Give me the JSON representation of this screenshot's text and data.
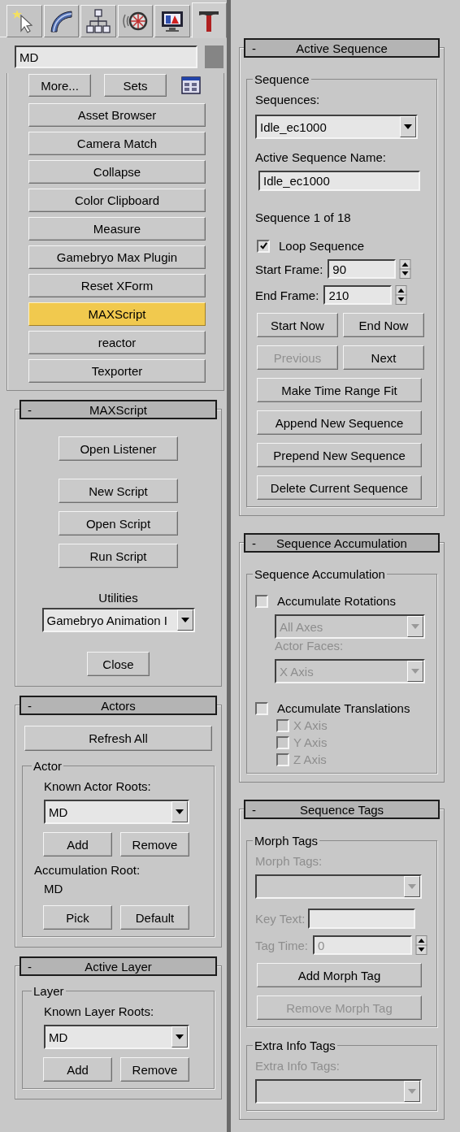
{
  "command_tabs": [
    {
      "kind": "create",
      "selected": false
    },
    {
      "kind": "modify",
      "selected": false
    },
    {
      "kind": "hierarchy",
      "selected": false
    },
    {
      "kind": "motion",
      "selected": false
    },
    {
      "kind": "display",
      "selected": false
    },
    {
      "kind": "utilities",
      "selected": true
    }
  ],
  "name_field": {
    "value": "MD"
  },
  "utilities": {
    "more_button": "More...",
    "sets_button": "Sets",
    "buttons": [
      {
        "label": "Asset Browser",
        "selected": false
      },
      {
        "label": "Camera Match",
        "selected": false
      },
      {
        "label": "Collapse",
        "selected": false
      },
      {
        "label": "Color Clipboard",
        "selected": false
      },
      {
        "label": "Measure",
        "selected": false
      },
      {
        "label": "Gamebryo Max Plugin",
        "selected": false
      },
      {
        "label": "Reset XForm",
        "selected": false
      },
      {
        "label": "MAXScript",
        "selected": true
      },
      {
        "label": "reactor",
        "selected": false
      },
      {
        "label": "Texporter",
        "selected": false
      }
    ]
  },
  "maxscript": {
    "collapse": "-",
    "title": "MAXScript",
    "buttons": [
      "Open Listener",
      "New Script",
      "Open Script",
      "Run Script"
    ],
    "utilities_label": "Utilities",
    "utilities_dropdown": "Gamebryo Animation I",
    "close_button": "Close"
  },
  "actors": {
    "collapse": "-",
    "title": "Actors",
    "refresh_button": "Refresh All",
    "group_label": "Actor",
    "roots_label": "Known Actor Roots:",
    "roots_dropdown": "MD",
    "add_button": "Add",
    "remove_button": "Remove",
    "accumulation_label": "Accumulation Root:",
    "accumulation_value": "MD",
    "pick_button": "Pick",
    "default_button": "Default"
  },
  "active_layer": {
    "collapse": "-",
    "title": "Active Layer",
    "group_label": "Layer",
    "roots_label": "Known Layer Roots:",
    "roots_dropdown": "MD",
    "add_button": "Add",
    "remove_button": "Remove"
  },
  "active_sequence": {
    "collapse": "-",
    "title": "Active Sequence",
    "group_label": "Sequence",
    "sequences_label": "Sequences:",
    "sequences_dropdown": "Idle_ec1000",
    "name_label": "Active Sequence Name:",
    "name_value": "Idle_ec1000",
    "counter": "Sequence 1 of 18",
    "loop": {
      "label": "Loop Sequence",
      "checked": true
    },
    "start_label": "Start Frame:",
    "start_value": "90",
    "end_label": "End Frame:",
    "end_value": "210",
    "button_rows": [
      {
        "buttons": [
          {
            "label": "Start Now",
            "disabled": false
          },
          {
            "label": "End Now",
            "disabled": false
          }
        ]
      },
      {
        "buttons": [
          {
            "label": "Previous",
            "disabled": true
          },
          {
            "label": "Next",
            "disabled": false
          }
        ]
      }
    ],
    "buttons": [
      {
        "label": "Make Time Range Fit",
        "disabled": false
      },
      {
        "label": "Append New Sequence",
        "disabled": false
      },
      {
        "label": "Prepend New Sequence",
        "disabled": false
      },
      {
        "label": "Delete Current Sequence",
        "disabled": false
      }
    ]
  },
  "sequence_accumulation": {
    "collapse": "-",
    "title": "Sequence Accumulation",
    "group_label": "Sequence Accumulation",
    "rotations": {
      "label": "Accumulate Rotations",
      "checked": false
    },
    "axes_dropdown": {
      "value": "All Axes",
      "disabled": true
    },
    "faces_label": {
      "text": "Actor Faces:",
      "disabled": true
    },
    "faces_dropdown": {
      "value": "X Axis",
      "disabled": true
    },
    "translations": {
      "label": "Accumulate Translations",
      "checked": false
    },
    "axes": [
      {
        "label": "X Axis",
        "checked": false,
        "disabled": true
      },
      {
        "label": "Y Axis",
        "checked": false,
        "disabled": true
      },
      {
        "label": "Z Axis",
        "checked": false,
        "disabled": true
      }
    ]
  },
  "sequence_tags": {
    "collapse": "-",
    "title": "Sequence Tags",
    "morph_group_label": "Morph Tags",
    "morph_label": {
      "text": "Morph Tags:",
      "disabled": true
    },
    "morph_dropdown": {
      "disabled": true
    },
    "key_text_label": {
      "text": "Key Text:",
      "disabled": true
    },
    "tag_time_label": {
      "text": "Tag Time:",
      "disabled": true
    },
    "tag_time_value": "0",
    "add_button": {
      "label": "Add Morph Tag",
      "disabled": false
    },
    "remove_button": {
      "label": "Remove Morph Tag",
      "disabled": true
    },
    "extra_group_label": "Extra Info Tags",
    "extra_label": {
      "text": "Extra Info Tags:",
      "disabled": true
    },
    "extra_dropdown": {
      "disabled": true
    }
  }
}
